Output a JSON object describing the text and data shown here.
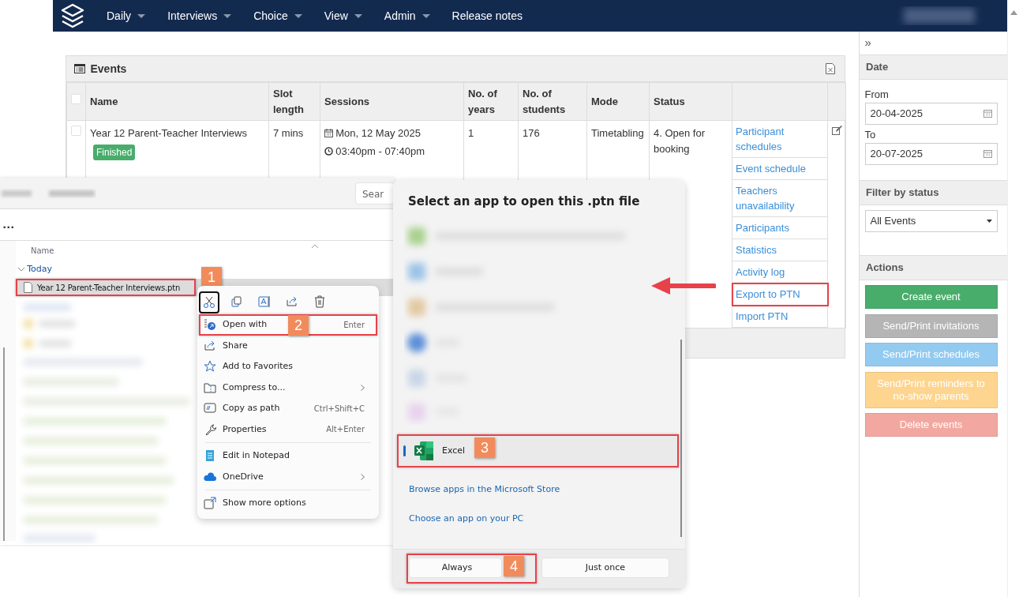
{
  "nav": {
    "items": [
      {
        "label": "Daily",
        "dropdown": true
      },
      {
        "label": "Interviews",
        "dropdown": true
      },
      {
        "label": "Choice",
        "dropdown": true
      },
      {
        "label": "View",
        "dropdown": true
      },
      {
        "label": "Admin",
        "dropdown": true
      },
      {
        "label": "Release notes",
        "dropdown": false
      }
    ]
  },
  "events": {
    "title": "Events",
    "header_checked": false,
    "columns": [
      "Name",
      "Slot length",
      "Sessions",
      "No. of years",
      "No. of students",
      "Mode",
      "Status"
    ],
    "row": {
      "checked": false,
      "name": "Year 12 Parent-Teacher Interviews",
      "badge": "Finished",
      "slot": "7 mins",
      "date": "Mon, 12 May 2025",
      "time": "03:40pm - 07:40pm",
      "years": "1",
      "students": "176",
      "mode": "Timetabling",
      "status": "4. Open for booking",
      "actions": [
        {
          "label": "Participant schedules",
          "highlighted": false
        },
        {
          "label": "Event schedule",
          "highlighted": false
        },
        {
          "label": "Teachers unavailability",
          "highlighted": false
        },
        {
          "label": "Participants",
          "highlighted": false
        },
        {
          "label": "Statistics",
          "highlighted": false
        },
        {
          "label": "Activity log",
          "highlighted": false
        },
        {
          "label": "Export to PTN",
          "highlighted": true
        },
        {
          "label": "Import PTN",
          "highlighted": false
        }
      ]
    }
  },
  "sidebar": {
    "collapse": "»",
    "date_title": "Date",
    "fields": [
      {
        "label": "From",
        "value": "20-04-2025"
      },
      {
        "label": "To",
        "value": "20-07-2025"
      }
    ],
    "filter_title": "Filter by status",
    "filter_value": "All Events",
    "actions_title": "Actions",
    "buttons": [
      {
        "label": "Create event",
        "color": "#48ad6b"
      },
      {
        "label": "Send/Print invitations",
        "color": "#b5b5b5"
      },
      {
        "label": "Send/Print schedules",
        "color": "#93caf0"
      },
      {
        "label": "Send/Print reminders to no-show parents",
        "color": "#fdd58e"
      },
      {
        "label": "Delete events",
        "color": "#f2a8a0"
      }
    ]
  },
  "explorer": {
    "search": "Sear",
    "more": "...",
    "column": "Name",
    "group": "Today",
    "file": {
      "name": "Year 12 Parent-Teacher Interviews.ptn",
      "selected": true,
      "highlighted": true,
      "step": "1"
    }
  },
  "context_menu": {
    "toolbar": [
      {
        "selected": true
      },
      {
        "selected": false
      },
      {
        "selected": false
      },
      {
        "selected": false
      },
      {
        "selected": false
      }
    ],
    "items": [
      {
        "kind": "item",
        "label": "Open with",
        "shortcut": "Enter",
        "submenu": false,
        "highlighted": true,
        "step": "2"
      },
      {
        "kind": "item",
        "label": "Share",
        "submenu": false,
        "highlighted": false
      },
      {
        "kind": "item",
        "label": "Add to Favorites",
        "submenu": false,
        "highlighted": false
      },
      {
        "kind": "item",
        "label": "Compress to...",
        "submenu": true,
        "highlighted": false
      },
      {
        "kind": "item",
        "label": "Copy as path",
        "shortcut": "Ctrl+Shift+C",
        "submenu": false,
        "highlighted": false
      },
      {
        "kind": "item",
        "label": "Properties",
        "shortcut": "Alt+Enter",
        "submenu": false,
        "highlighted": false
      },
      {
        "kind": "separator"
      },
      {
        "kind": "item",
        "label": "Edit in Notepad",
        "submenu": false,
        "highlighted": false
      },
      {
        "kind": "item",
        "label": "OneDrive",
        "submenu": true,
        "highlighted": false
      },
      {
        "kind": "separator"
      },
      {
        "kind": "item",
        "label": "Show more options",
        "submenu": false,
        "highlighted": false
      }
    ]
  },
  "dialog": {
    "title": "Select an app to open this .ptn file",
    "apps": [
      {
        "label": "Excel",
        "selected": true,
        "highlighted": true,
        "step": "3"
      }
    ],
    "links": [
      "Browse apps in the Microsoft Store",
      "Choose an app on your PC"
    ],
    "buttons": [
      {
        "label": "Always",
        "highlighted": true,
        "step": "4"
      },
      {
        "label": "Just once",
        "highlighted": false
      }
    ]
  }
}
